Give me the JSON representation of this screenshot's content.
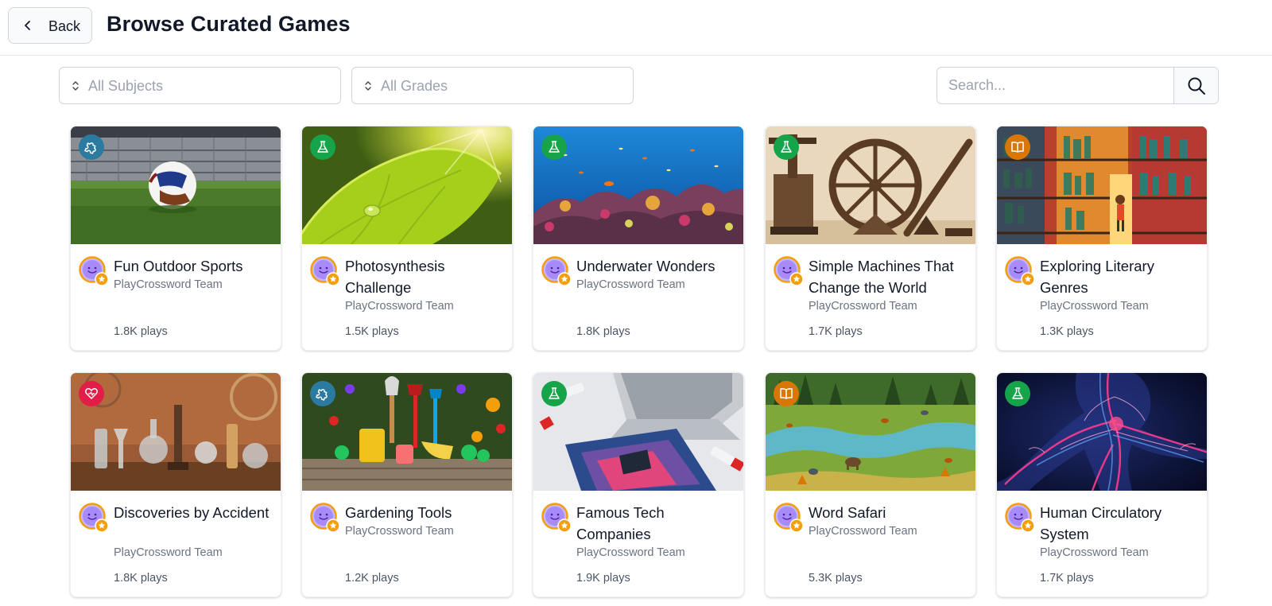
{
  "header": {
    "back_label": "Back",
    "title": "Browse Curated Games"
  },
  "filters": {
    "subjects_placeholder": "All Subjects",
    "grades_placeholder": "All Grades",
    "search_placeholder": "Search..."
  },
  "colors": {
    "accent_star": "#f59e0b",
    "avatar_purple": "#a78bfa",
    "badge_blue": "#2b7a9f",
    "badge_green": "#16a34a",
    "badge_orange": "#d97706",
    "badge_pink": "#e11d48"
  },
  "cards": [
    {
      "title": "Fun Outdoor Sports",
      "author": "PlayCrossword Team",
      "plays": "1.8K plays",
      "badge_icon": "puzzle-icon",
      "theme": "soccer-ball-on-field"
    },
    {
      "title": "Photosynthesis Challenge",
      "author": "PlayCrossword Team",
      "plays": "1.5K plays",
      "badge_icon": "flask-icon",
      "theme": "green-leaf-sunlight"
    },
    {
      "title": "Underwater Wonders",
      "author": "PlayCrossword Team",
      "plays": "1.8K plays",
      "badge_icon": "flask-icon",
      "theme": "coral-reef"
    },
    {
      "title": "Simple Machines That Change the World",
      "author": "PlayCrossword Team",
      "plays": "1.7K plays",
      "badge_icon": "flask-icon",
      "theme": "wheel-and-lever"
    },
    {
      "title": "Exploring Literary Genres",
      "author": "PlayCrossword Team",
      "plays": "1.3K plays",
      "badge_icon": "book-icon",
      "theme": "library-shelves"
    },
    {
      "title": "Discoveries by Accident",
      "author": "PlayCrossword Team",
      "plays": "1.8K plays",
      "badge_icon": "heart-icon",
      "theme": "lab-glassware"
    },
    {
      "title": "Gardening Tools",
      "author": "PlayCrossword Team",
      "plays": "1.2K plays",
      "badge_icon": "puzzle-icon",
      "theme": "garden-tools"
    },
    {
      "title": "Famous Tech Companies",
      "author": "PlayCrossword Team",
      "plays": "1.9K plays",
      "badge_icon": "flask-icon",
      "theme": "laptop-and-paints"
    },
    {
      "title": "Word Safari",
      "author": "PlayCrossword Team",
      "plays": "5.3K plays",
      "badge_icon": "book-icon",
      "theme": "savanna-landscape"
    },
    {
      "title": "Human Circulatory System",
      "author": "PlayCrossword Team",
      "plays": "1.7K plays",
      "badge_icon": "flask-icon",
      "theme": "circulatory-system"
    }
  ]
}
